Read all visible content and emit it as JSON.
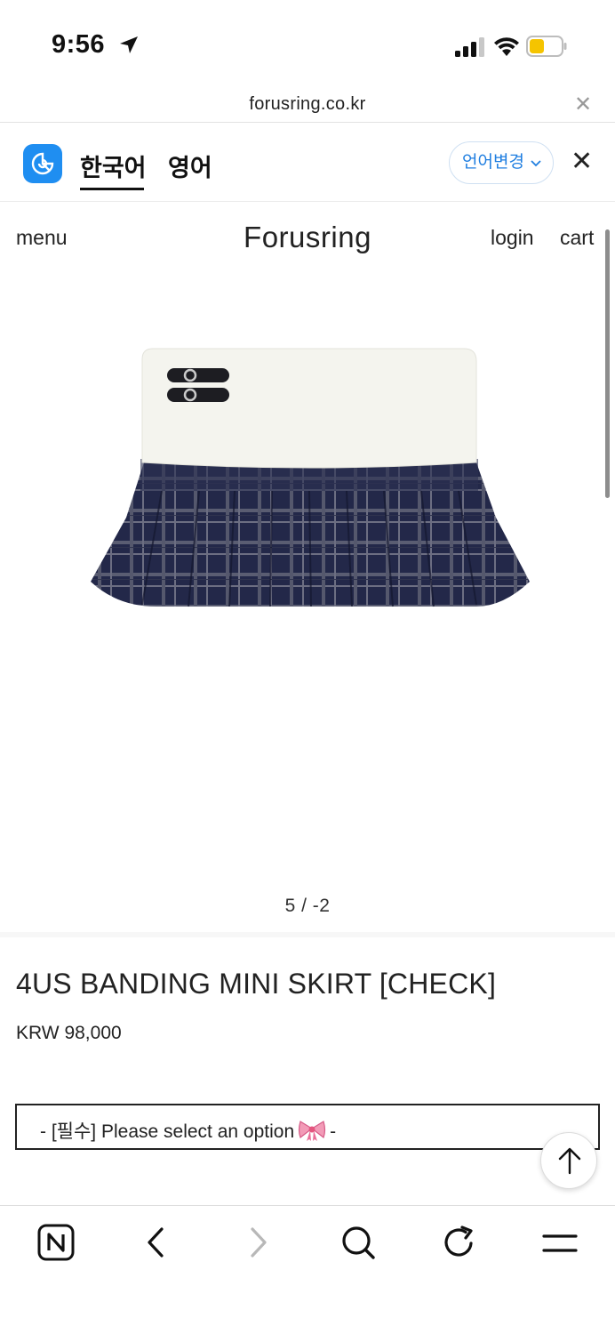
{
  "status_bar": {
    "time": "9:56",
    "colors": {
      "battery": "#f5c400"
    }
  },
  "browser": {
    "url": "forusring.co.kr"
  },
  "translate_bar": {
    "lang_source": "한국어",
    "lang_target": "영어",
    "change_label": "언어변경",
    "accent": "#1f7ee0"
  },
  "site_header": {
    "menu": "menu",
    "logo": "Forusring",
    "login": "login",
    "cart": "cart"
  },
  "gallery": {
    "pager": "5 / -2",
    "image_alt": "mini skirt with white waistband and navy check pleats"
  },
  "product": {
    "name": "4US BANDING MINI SKIRT [CHECK]",
    "price": "KRW 98,000",
    "option_prefix": "- [필수] Please select an option",
    "option_suffix": "-"
  },
  "toolbar": {
    "icons": [
      "naver-icon",
      "back-icon",
      "forward-icon",
      "search-icon",
      "refresh-icon",
      "menu-icon"
    ]
  }
}
